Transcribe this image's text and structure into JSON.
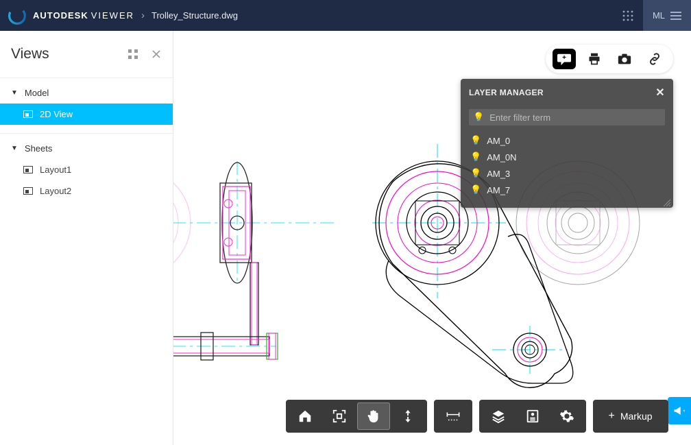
{
  "header": {
    "brand_bold": "AUTODESK",
    "brand_thin": "VIEWER",
    "breadcrumb_separator": "›",
    "filename": "Trolley_Structure.dwg",
    "user_initials": "ML"
  },
  "sidebar": {
    "title": "Views",
    "sections": [
      {
        "label": "Model",
        "items": [
          {
            "label": "2D View",
            "active": true
          }
        ]
      },
      {
        "label": "Sheets",
        "items": [
          {
            "label": "Layout1"
          },
          {
            "label": "Layout2"
          }
        ]
      }
    ]
  },
  "action_bar": {
    "comment_icon": "comment",
    "print_icon": "print",
    "screenshot_icon": "camera",
    "share_icon": "link"
  },
  "layer_manager": {
    "title": "LAYER MANAGER",
    "filter_placeholder": "Enter filter term",
    "layers": [
      {
        "name": "AM_0"
      },
      {
        "name": "AM_0N"
      },
      {
        "name": "AM_3"
      },
      {
        "name": "AM_7"
      }
    ]
  },
  "toolbar": {
    "home": "home",
    "fit": "fit-to-view",
    "pan": "pan",
    "vpan": "vertical-pan",
    "measure": "measure",
    "layers": "layers",
    "properties": "properties",
    "settings": "settings",
    "markup_label": "Markup",
    "markup_plus": "+"
  }
}
